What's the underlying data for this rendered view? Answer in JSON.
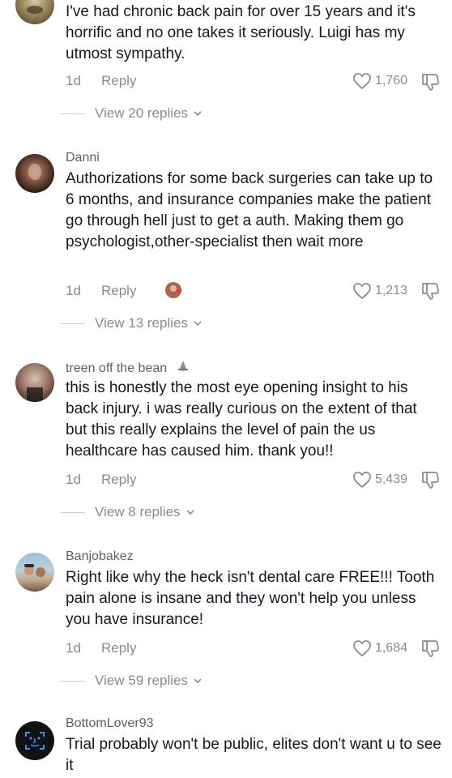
{
  "comments": [
    {
      "username": "",
      "text": "I've had chronic back pain for over 15 years and it's horrific and no one takes it seriously. Luigi has my utmost sympathy.",
      "time": "1d",
      "reply_label": "Reply",
      "likes": "1,760",
      "view_replies": "View 20 replies"
    },
    {
      "username": "Danni",
      "text": "Authorizations for some back surgeries can take up to 6 months, and insurance companies make the patient go through hell just to get a auth. Making them go psychologist,other-specialist then wait more",
      "time": "1d",
      "reply_label": "Reply",
      "likes": "1,213",
      "view_replies": "View 13 replies"
    },
    {
      "username": "treen off the bean",
      "text": "this is honestly the most eye opening insight to his back injury. i was really curious on the extent of that but this really explains the level of pain the us healthcare has caused him. thank you!!",
      "time": "1d",
      "reply_label": "Reply",
      "likes": "5,439",
      "view_replies": "View 8 replies"
    },
    {
      "username": "Banjobakez",
      "text": "Right like why the heck isn't dental care FREE!!! Tooth pain alone is insane and they won't help you unless you have insurance!",
      "time": "1d",
      "reply_label": "Reply",
      "likes": "1,684",
      "view_replies": "View 59 replies"
    },
    {
      "username": "BottomLover93",
      "text": "Trial probably won't be public, elites don't want u to see it"
    }
  ]
}
